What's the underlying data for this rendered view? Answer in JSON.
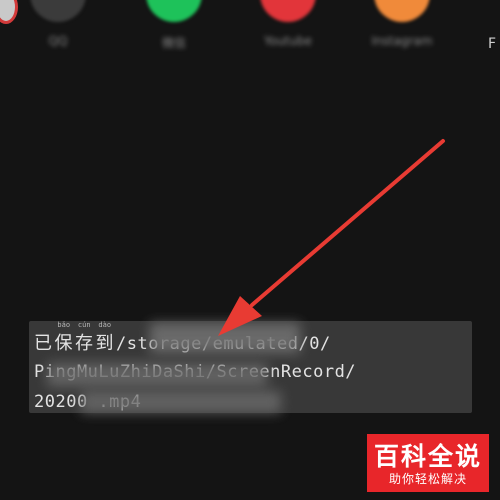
{
  "share_bar": {
    "items": [
      {
        "label": "QQ",
        "color": "#3b3b3b"
      },
      {
        "label": "微信",
        "color": "#1ec25a"
      },
      {
        "label": "Youtube",
        "color": "#e2353a"
      },
      {
        "label": "Instagram",
        "color": "#f08a3a"
      }
    ],
    "edge_letter": "F"
  },
  "toast": {
    "line1_ruby": [
      {
        "ch": "已",
        "py": ""
      },
      {
        "ch": "保",
        "py": "bǎo"
      },
      {
        "ch": "存",
        "py": "cún"
      },
      {
        "ch": "到",
        "py": "dào"
      }
    ],
    "line1_text": "/storage/emulated/0/",
    "line2_text": "PingMuLuZhiDaShi/ScreenRecord/",
    "line3_text": "20200                    .mp4"
  },
  "arrow": {
    "color": "#e83b33",
    "icon": "red-arrow-icon"
  },
  "watermark": {
    "title": "百科全说",
    "subtitle": "助你轻松解决",
    "color": "#e8262a"
  }
}
